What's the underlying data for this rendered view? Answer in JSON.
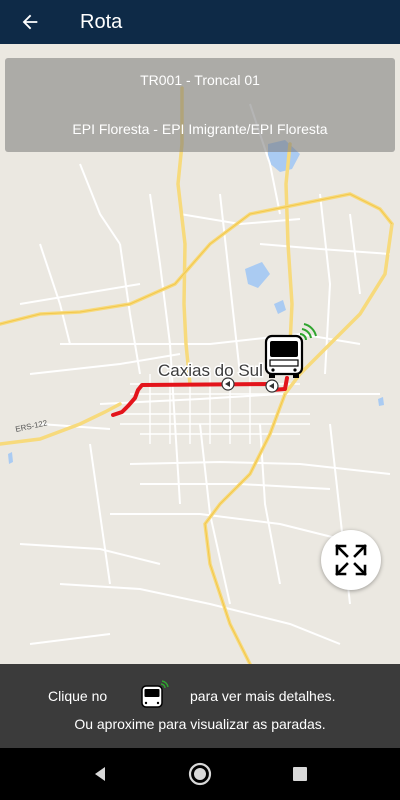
{
  "app_bar": {
    "title": "Rota",
    "back_icon": "arrow-left-icon"
  },
  "route_card": {
    "code": "TR001 - Troncal 01",
    "description": "EPI Floresta - EPI Imigrante/EPI Floresta"
  },
  "map": {
    "city_label": "Caxias do Sul",
    "road_label": "ERS-122",
    "route_color": "#e3141b",
    "stop_icon": "bus-stop-arrow-icon",
    "vehicle_icon": "bus-live-icon"
  },
  "expand_button": {
    "icon": "fullscreen-expand-icon"
  },
  "info_panel": {
    "click_text": "Clique no",
    "details_text": "para ver mais detalhes.",
    "zoom_text": "Ou aproxime para visualizar as paradas."
  },
  "system_nav": {
    "back_icon": "nav-back-icon",
    "home_icon": "nav-home-icon",
    "recents_icon": "nav-recents-icon"
  },
  "colors": {
    "app_bar": "#0e2a47",
    "info_panel": "#3b3b3b",
    "route_line": "#e3141b",
    "signal": "#2fa52f"
  }
}
